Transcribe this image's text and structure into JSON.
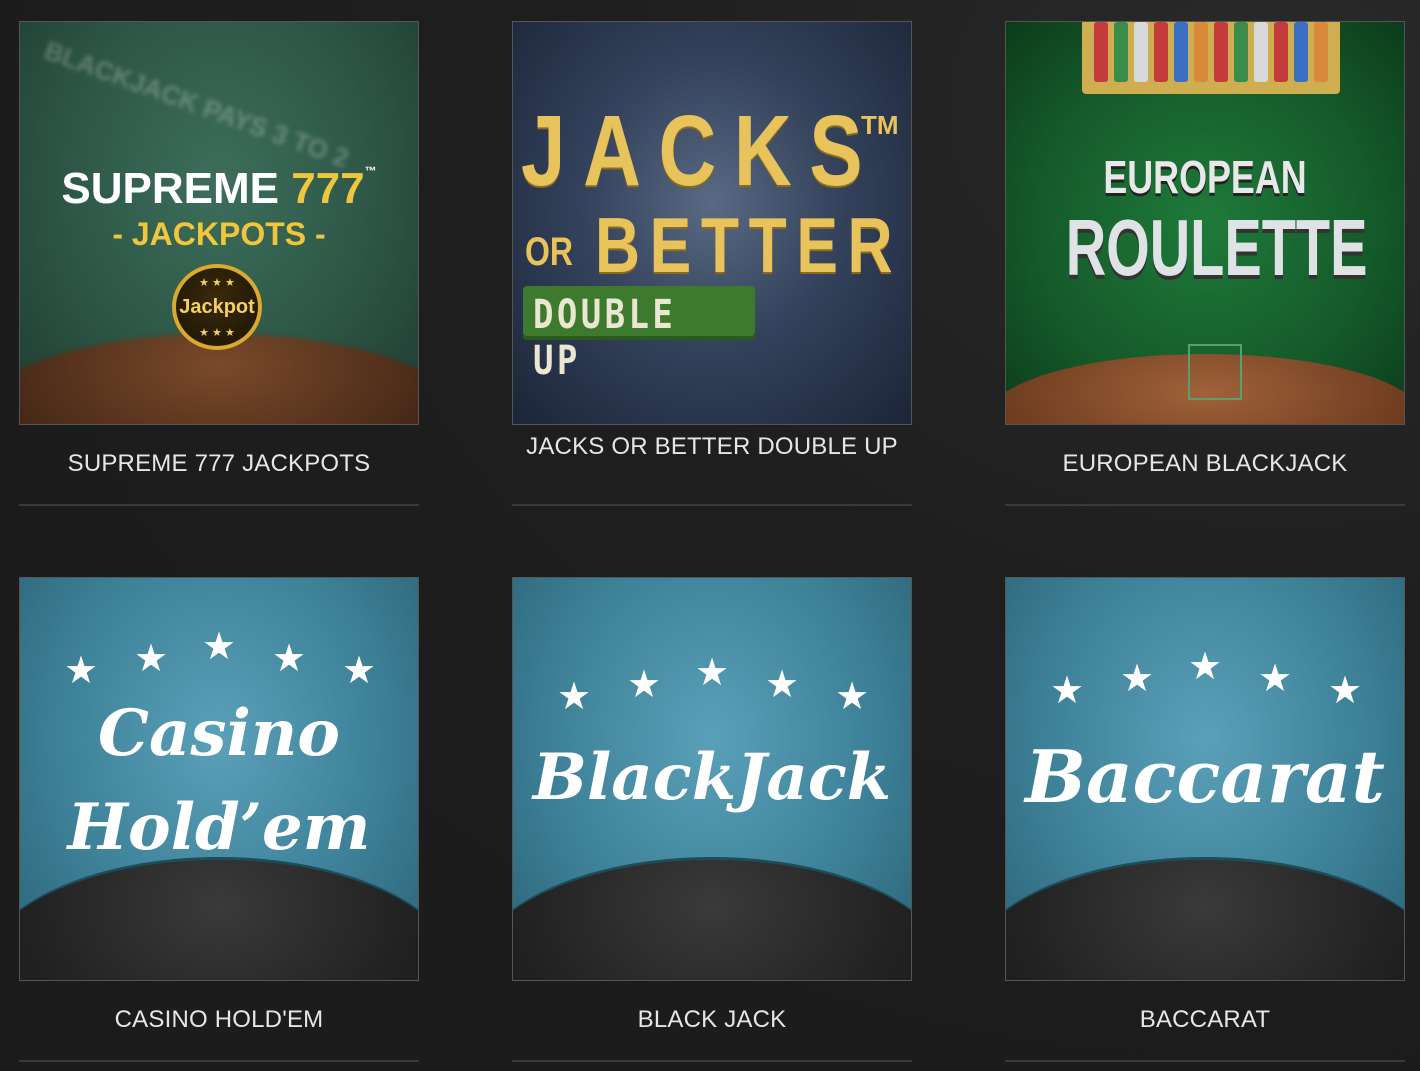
{
  "games": [
    {
      "title": "SUPREME 777 JACKPOTS",
      "art": {
        "line1": "SUPREME",
        "line1_num": "777",
        "tm": "™",
        "line2": "- JACKPOTS -",
        "badge": "Jackpot",
        "badge_stars": "★ ★ ★",
        "bg_text": "BLACKJACK PAYS 3 TO 2"
      }
    },
    {
      "title": "JACKS OR BETTER DOUBLE UP",
      "art": {
        "line1": "JACKS",
        "tm": "TM",
        "or": "OR",
        "line2": "BETTER",
        "line3": "DOUBLE UP"
      }
    },
    {
      "title": "EUROPEAN BLACKJACK",
      "art": {
        "line1": "EUROPEAN",
        "line2": "ROULETTE"
      }
    },
    {
      "title": "CASINO HOLD'EM",
      "art": {
        "line1": "Casino",
        "line2": "Hold’em"
      }
    },
    {
      "title": "BLACK JACK",
      "art": {
        "line1": "BlackJack"
      }
    },
    {
      "title": "BACCARAT",
      "art": {
        "line1": "Baccarat"
      }
    }
  ],
  "colors": {
    "background": "#1e1e1e",
    "title_text": "#e6e6e6",
    "divider": "#3a3a3a",
    "gold": "#f0c63d",
    "teal": "#3e8299"
  }
}
